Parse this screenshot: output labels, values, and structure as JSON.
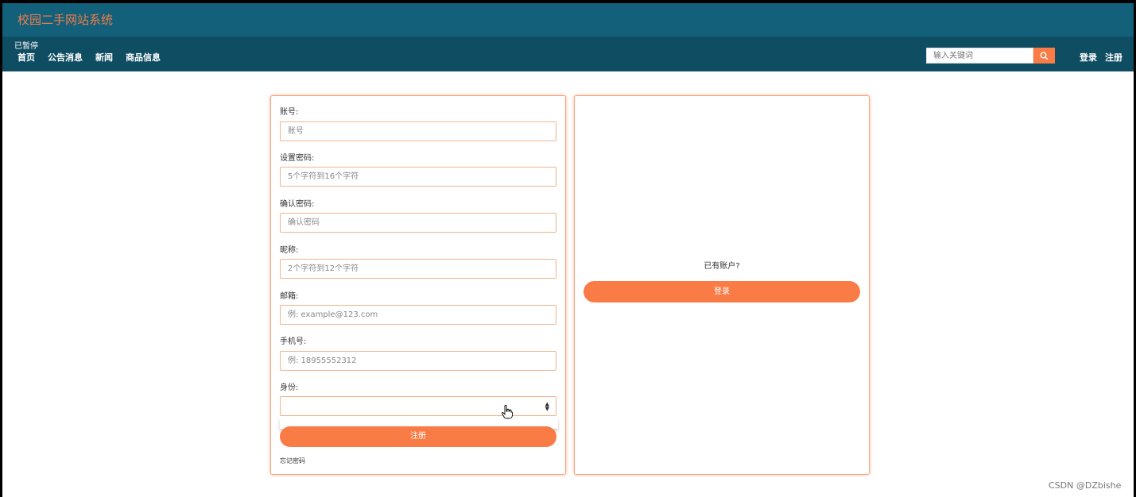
{
  "header": {
    "site_title": "校园二手网站系统",
    "paused_label": "已暂停"
  },
  "nav": {
    "items": [
      "首页",
      "公告消息",
      "新闻",
      "商品信息"
    ],
    "search_placeholder": "输入关键词",
    "login": "登录",
    "register": "注册"
  },
  "register_form": {
    "account_label": "账号:",
    "account_placeholder": "账号",
    "password_label": "设置密码:",
    "password_placeholder": "5个字符到16个字符",
    "confirm_label": "确认密码:",
    "confirm_placeholder": "确认密码",
    "nickname_label": "昵称:",
    "nickname_placeholder": "2个字符到12个字符",
    "email_label": "邮箱:",
    "email_placeholder": "例: example@123.com",
    "phone_label": "手机号:",
    "phone_placeholder": "例: 18955552312",
    "role_label": "身份:",
    "role_value": "",
    "submit_label": "注册",
    "forgot_label": "忘记密码"
  },
  "login_panel": {
    "have_account": "已有账户?",
    "login_label": "登录"
  },
  "watermark": "CSDN @DZbishe",
  "colors": {
    "header_bg": "#126079",
    "nav_bg": "#0f4d63",
    "accent": "#f97b45",
    "title_color": "#f27d4c"
  }
}
